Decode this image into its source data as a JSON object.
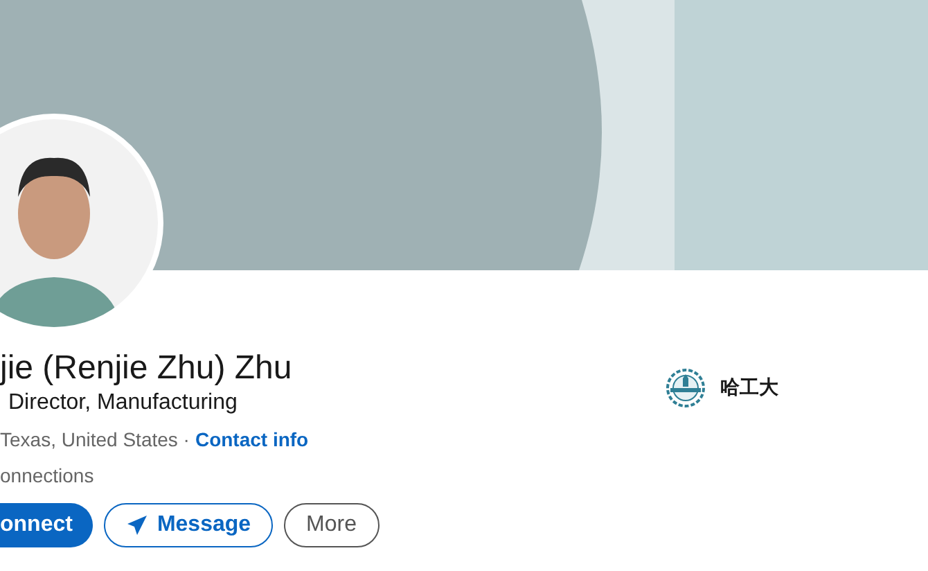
{
  "profile": {
    "name": "jie (Renjie Zhu) Zhu",
    "headline": "Director, Manufacturing",
    "location": "Texas, United States ·",
    "contact_link": "Contact info",
    "connections": "onnections"
  },
  "actions": [
    {
      "label": "onnect",
      "kind": "primary"
    },
    {
      "label": "Message",
      "kind": "message"
    },
    {
      "label": "More",
      "kind": "outline"
    }
  ],
  "education": {
    "school": "哈工大"
  }
}
